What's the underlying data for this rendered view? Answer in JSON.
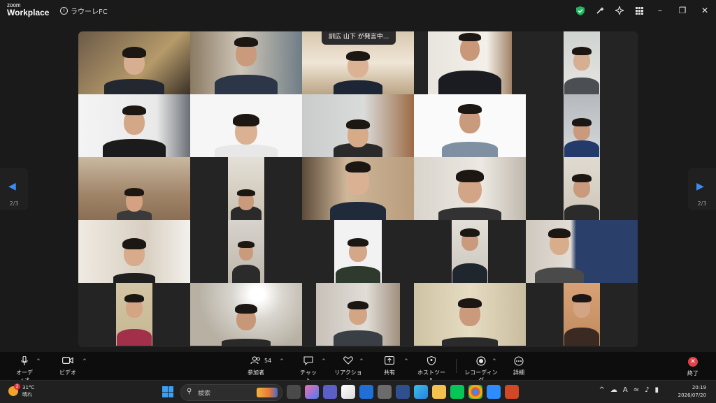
{
  "titlebar": {
    "logo_top": "zoom",
    "logo_bottom": "Workplace",
    "account_name": "ラウーレFC",
    "icons": [
      "shield-check-icon",
      "pen-sparkle-icon",
      "sparkle-icon",
      "apps-grid-icon"
    ],
    "window_controls": [
      "minimize-icon",
      "restore-icon",
      "close-icon"
    ]
  },
  "speaker_banner": "訓広 山下 が発言中...",
  "pager": {
    "left_page": "2/3",
    "right_page": "2/3"
  },
  "colors": {
    "accent": "#3d8af7",
    "end": "#e0424b",
    "shield": "#1fb860"
  },
  "toolbar": {
    "audio_label": "オーディオ",
    "video_label": "ビデオ",
    "participants_label": "参加者",
    "participants_count": "54",
    "chat_label": "チャット",
    "reaction_label": "リアクション",
    "share_label": "共有",
    "host_tools_label": "ホストツール",
    "record_label": "レコーディング",
    "more_label": "詳細",
    "end_label": "終了"
  },
  "taskbar": {
    "temperature": "31°C",
    "weather": "晴れ",
    "weather_badge": "2",
    "search_placeholder": "検索",
    "time": "20:19",
    "date": "2026/07/20"
  }
}
